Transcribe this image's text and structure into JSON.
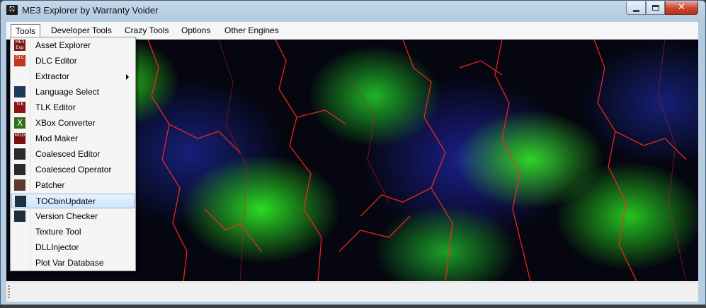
{
  "window": {
    "title": "ME3 Explorer by Warranty Voider",
    "app_icon_glyph": "⛞",
    "controls": {
      "minimize": "minimize-icon",
      "maximize": "maximize-icon",
      "close_glyph": "✕"
    }
  },
  "menubar": {
    "items": [
      "Tools",
      "Developer Tools",
      "Crazy Tools",
      "Options",
      "Other Engines"
    ],
    "open_index": 0
  },
  "tools_menu": {
    "items": [
      {
        "label": "Asset Explorer",
        "icon": "asset-explorer-icon",
        "icon_text": "ME3 Exp",
        "icon_color": "#7a1a14"
      },
      {
        "label": "DLC Editor",
        "icon": "dlc-editor-icon",
        "icon_text": "DLC",
        "icon_color": "#c2381d"
      },
      {
        "label": "Extractor",
        "icon": "",
        "icon_text": "",
        "icon_color": "",
        "submenu": true
      },
      {
        "label": "Language Select",
        "icon": "language-select-icon",
        "icon_text": "",
        "icon_color": "#1d3a5a"
      },
      {
        "label": "TLK Editor",
        "icon": "tlk-editor-icon",
        "icon_text": "TLK",
        "icon_color": "#8c1414"
      },
      {
        "label": "XBox Converter",
        "icon": "xbox-converter-icon",
        "icon_text": "X",
        "icon_color": "#2f6d1a"
      },
      {
        "label": "Mod Maker",
        "icon": "mod-maker-icon",
        "icon_text": "MOD",
        "icon_color": "#7a1010"
      },
      {
        "label": "Coalesced Editor",
        "icon": "coalesced-editor-icon",
        "icon_text": "",
        "icon_color": "#2a2a2a"
      },
      {
        "label": "Coalesced Operator",
        "icon": "coalesced-operator-icon",
        "icon_text": "",
        "icon_color": "#2a2a2a"
      },
      {
        "label": "Patcher",
        "icon": "patcher-icon",
        "icon_text": "",
        "icon_color": "#5a3a2a"
      },
      {
        "label": "TOCbinUpdater",
        "icon": "tocbin-updater-icon",
        "icon_text": "",
        "icon_color": "#1e2f40"
      },
      {
        "label": "Version Checker",
        "icon": "version-checker-icon",
        "icon_text": "",
        "icon_color": "#1e2f40"
      },
      {
        "label": "Texture Tool",
        "icon": "",
        "icon_text": "",
        "icon_color": ""
      },
      {
        "label": "DLLInjector",
        "icon": "",
        "icon_text": "",
        "icon_color": ""
      },
      {
        "label": "Plot Var Database",
        "icon": "",
        "icon_text": "",
        "icon_color": ""
      }
    ],
    "highlighted_index": 10
  },
  "colors": {
    "menu_highlight": "#cfe5fc",
    "title_bar": "#c6d8ea",
    "close_button": "#c8452e"
  }
}
